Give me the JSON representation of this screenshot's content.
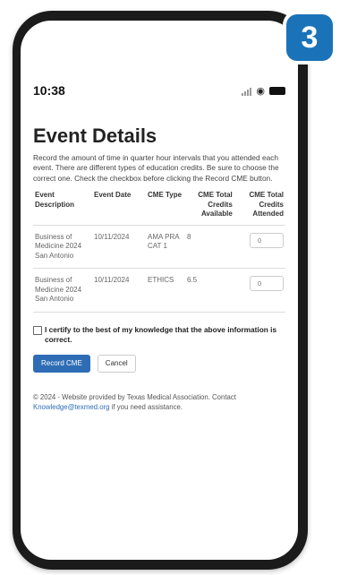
{
  "badge": "3",
  "status_bar": {
    "time": "10:38"
  },
  "page": {
    "title": "Event Details",
    "intro": "Record the amount of time in quarter hour intervals that you attended each event. There are different types of education credits. Be sure to choose the correct one. Check the checkbox before clicking the Record CME button."
  },
  "table": {
    "headers": [
      "Event Description",
      "Event Date",
      "CME Type",
      "CME Total Credits Available",
      "CME Total Credits Attended"
    ],
    "rows": [
      {
        "description": "Business of Medicine 2024 San Antonio",
        "date": "10/11/2024",
        "type": "AMA PRA CAT 1",
        "available": "8",
        "attended_placeholder": "0"
      },
      {
        "description": "Business of Medicine 2024 San Antonio",
        "date": "10/11/2024",
        "type": "ETHICS",
        "available": "6.5",
        "attended_placeholder": "0"
      }
    ]
  },
  "certify_label": "I certify to the best of my knowledge that the above information is correct.",
  "buttons": {
    "record": "Record CME",
    "cancel": "Cancel"
  },
  "footer": {
    "text_before": "© 2024 - Website provided by Texas Medical Association. Contact ",
    "email": "Knowledge@texmed.org",
    "text_after": " if you need assistance."
  },
  "colors": {
    "badge": "#1a73b8",
    "primary_button": "#2e6db5",
    "link": "#2e6db5"
  }
}
